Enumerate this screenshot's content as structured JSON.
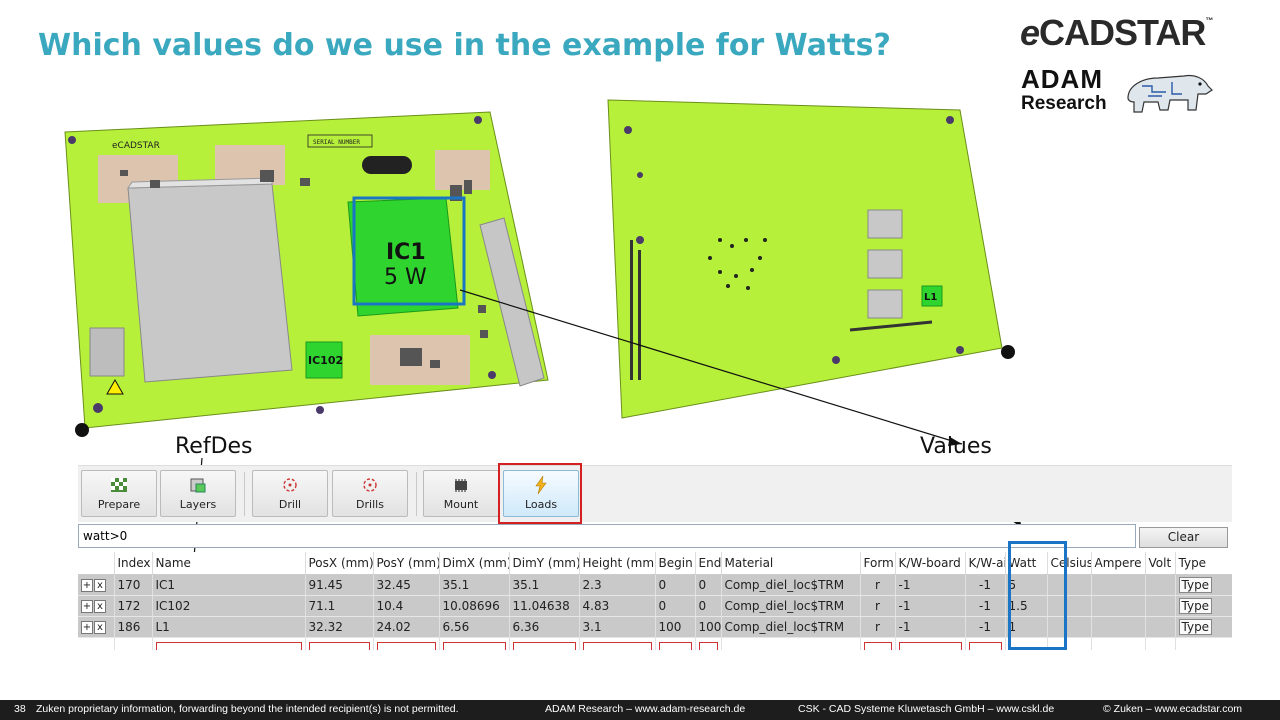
{
  "title": "Which values do we use in the example for Watts?",
  "logo": {
    "e": "e",
    "rest": "CADSTAR",
    "tm": "™"
  },
  "partner": {
    "line1": "ADAM",
    "line2": "Research"
  },
  "annotations": {
    "refdes": "RefDes",
    "values": "Values",
    "ic1_name": "IC1",
    "ic1_watt": "5 W"
  },
  "board": {
    "brand": "eCADSTAR",
    "serial": "SERIAL NUMBER",
    "ic102": "IC102",
    "l1": "L1"
  },
  "toolbar": {
    "buttons": [
      {
        "label": "Prepare",
        "icon": "prepare-icon"
      },
      {
        "label": "Layers",
        "icon": "layers-icon"
      },
      {
        "label": "Drill",
        "icon": "drill-icon"
      },
      {
        "label": "Drills",
        "icon": "drills-icon"
      },
      {
        "label": "Mount",
        "icon": "mount-icon"
      },
      {
        "label": "Loads",
        "icon": "lightning-icon"
      }
    ]
  },
  "filter": {
    "value": "watt>0",
    "clear_label": "Clear"
  },
  "grid": {
    "columns": [
      "",
      "Index",
      "Name",
      "PosX (mm)",
      "PosY (mm)",
      "DimX (mm)",
      "DimY (mm)",
      "Height (mm)",
      "Begin",
      "End",
      "Material",
      "Form",
      "K/W-board",
      "K/W-air",
      "Watt",
      "Celsius",
      "Ampere",
      "Volt",
      "Type"
    ],
    "rows": [
      {
        "index": "170",
        "name": "IC1",
        "posx": "91.45",
        "posy": "32.45",
        "dimx": "35.1",
        "dimy": "35.1",
        "height": "2.3",
        "begin": "0",
        "end": "0",
        "material": "Comp_diel_loc$TRM",
        "form": "r",
        "kwboard": "-1",
        "kwair": "-1",
        "watt": "5",
        "celsius": "",
        "ampere": "",
        "volt": "",
        "type": "Type"
      },
      {
        "index": "172",
        "name": "IC102",
        "posx": "71.1",
        "posy": "10.4",
        "dimx": "10.08696",
        "dimy": "11.04638",
        "height": "4.83",
        "begin": "0",
        "end": "0",
        "material": "Comp_diel_loc$TRM",
        "form": "r",
        "kwboard": "-1",
        "kwair": "-1",
        "watt": "1.5",
        "celsius": "",
        "ampere": "",
        "volt": "",
        "type": "Type"
      },
      {
        "index": "186",
        "name": "L1",
        "posx": "32.32",
        "posy": "24.02",
        "dimx": "6.56",
        "dimy": "6.36",
        "height": "3.1",
        "begin": "100",
        "end": "100",
        "material": "Comp_diel_loc$TRM",
        "form": "r",
        "kwboard": "-1",
        "kwair": "-1",
        "watt": "1",
        "celsius": "",
        "ampere": "",
        "volt": "",
        "type": "Type"
      }
    ],
    "plus": "+",
    "x": "x"
  },
  "footer": {
    "page": "38",
    "notice": "Zuken proprietary information, forwarding beyond the intended recipient(s) is not permitted.",
    "adam": "ADAM Research – www.adam-research.de",
    "csk": "CSK - CAD Systeme Kluwetasch GmbH – www.cskl.de",
    "zuken": "© Zuken – www.ecadstar.com"
  },
  "colors": {
    "title": "#3aa8be",
    "board": "#b7f03a",
    "highlight": "#1a76c4",
    "loads_frame": "#d42020"
  }
}
